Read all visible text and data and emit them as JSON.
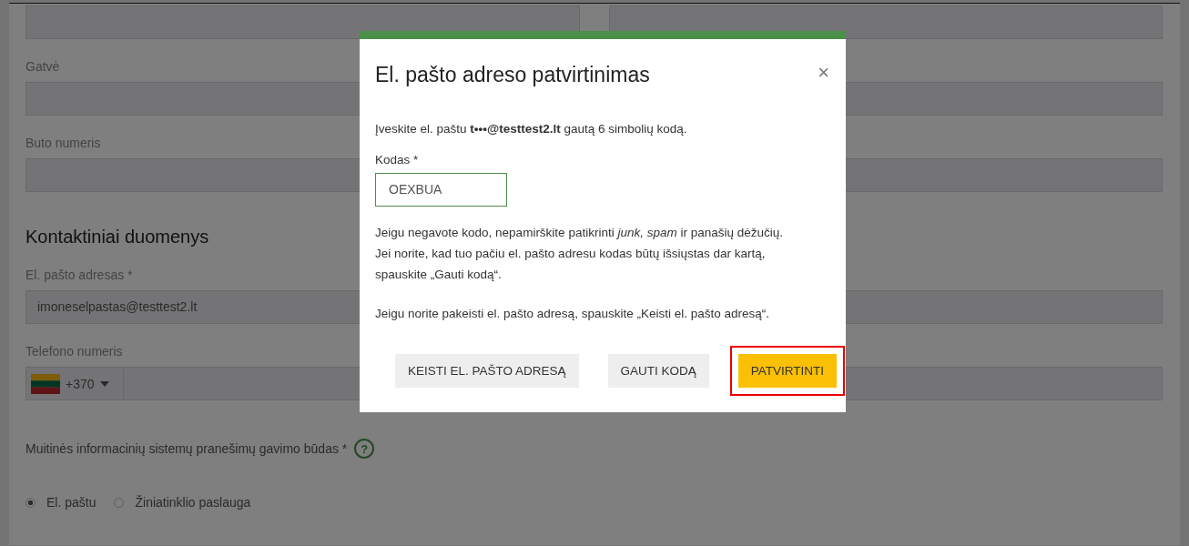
{
  "form": {
    "fields": [
      {
        "kind": "pair"
      },
      {
        "kind": "text",
        "label": "Gatvė"
      },
      {
        "kind": "text",
        "label": "Buto numeris"
      }
    ],
    "contact_heading": "Kontaktiniai duomenys",
    "email": {
      "label": "El. pašto adresas *",
      "value": "imoneselpastas@testtest2.lt"
    },
    "phone": {
      "label": "Telefono numeris",
      "country_code": "+370"
    },
    "delivery": {
      "label": "Muitinės informacinių sistemų pranešimų gavimo būdas *",
      "help": "?",
      "options": [
        {
          "label": "El. paštu",
          "selected": true
        },
        {
          "label": "Žiniatinklio paslauga",
          "selected": false
        }
      ]
    }
  },
  "dialog": {
    "title": "El. pašto adreso patvirtinimas",
    "close": "×",
    "intro": "Įveskite el. paštu **t•••@testtest2.lt** gautą 6 simbolių kodą.",
    "code_label": "Kodas *",
    "code_value": "OEXBUA",
    "hint_lines": [
      "Jeigu negavote kodo, nepamirškite patikrinti *junk, spam* ir panašių dėžučių.",
      "Jei norite, kad tuo pačiu el. pašto adresu kodas būtų išsiųstas dar kartą,",
      "spauskite „Gauti kodą“."
    ],
    "change_note": "Jeigu norite pakeisti el. pašto adresą, spauskite „Keisti el. pašto adresą“.",
    "buttons": [
      {
        "label": "KEISTI EL. PAŠTO ADRESĄ",
        "kind": "secondary",
        "highlighted": false
      },
      {
        "label": "GAUTI KODĄ",
        "kind": "secondary",
        "highlighted": false
      },
      {
        "label": "PATVIRTINTI",
        "kind": "primary",
        "highlighted": true
      }
    ]
  }
}
